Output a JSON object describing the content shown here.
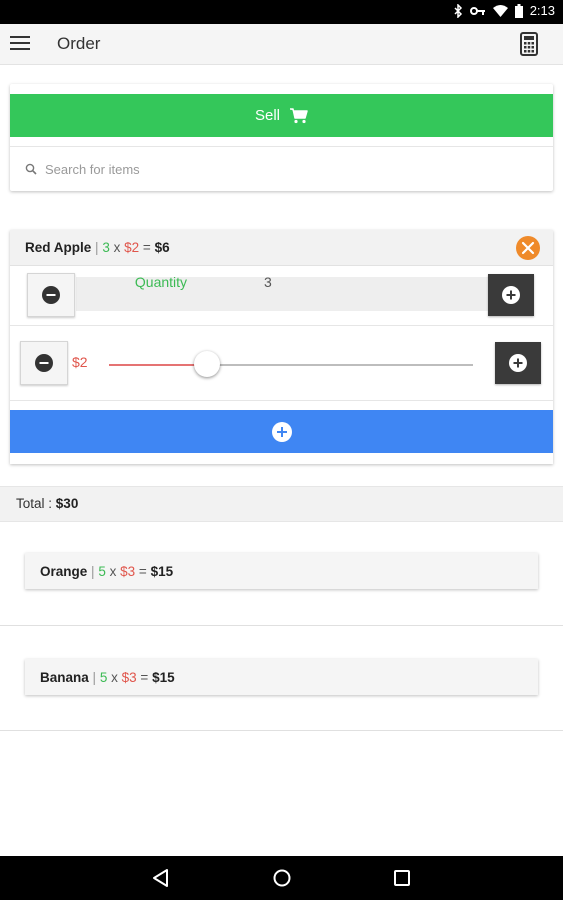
{
  "status_bar": {
    "time": "2:13",
    "icons": [
      "bluetooth-icon",
      "key-icon",
      "wifi-icon",
      "battery-icon"
    ]
  },
  "app_bar": {
    "title": "Order",
    "menu_icon": "hamburger-icon",
    "action_icon": "calculator-icon"
  },
  "sell": {
    "label": "Sell",
    "icon": "cart-icon",
    "color": "#34c75a"
  },
  "search": {
    "placeholder": "Search for items",
    "value": ""
  },
  "current_item": {
    "name": "Red Apple",
    "separator": "|",
    "quantity": "3",
    "times": "x",
    "price": "$2",
    "equals": "=",
    "total": "$6",
    "quantity_label": "Quantity",
    "quantity_value": "3",
    "price_label": "$2",
    "price_slider_fraction": 0.27,
    "add_button_color": "#3f86f3"
  },
  "total": {
    "label": "Total :",
    "value": "$30"
  },
  "orders": [
    {
      "name": "Orange",
      "separator": "|",
      "quantity": "5",
      "times": "x",
      "price": "$3",
      "equals": "=",
      "total": "$15"
    },
    {
      "name": "Banana",
      "separator": "|",
      "quantity": "5",
      "times": "x",
      "price": "$3",
      "equals": "=",
      "total": "$15"
    }
  ],
  "colors": {
    "quantity": "#3cba54",
    "price": "#e0554b",
    "close": "#ef8a2a",
    "dark_button": "#3a3a3a"
  },
  "nav_bar": {
    "icons": [
      "back-icon",
      "home-icon",
      "recents-icon"
    ]
  }
}
